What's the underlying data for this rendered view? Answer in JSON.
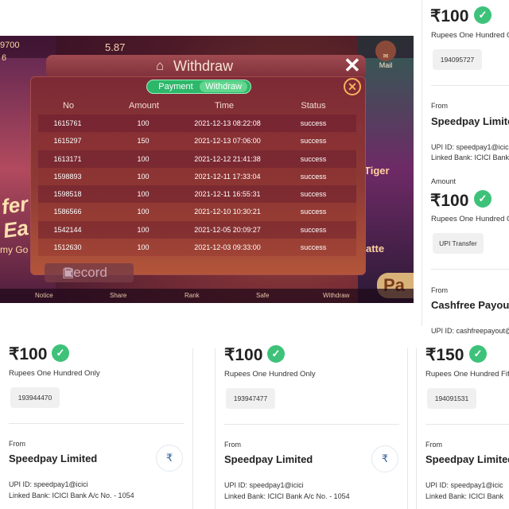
{
  "game": {
    "balance_a": "9700",
    "balance_b": "6",
    "balance_c": "5.87",
    "mail_label": "Mail",
    "side_promo_a": "fer",
    "side_promo_b": "Ea",
    "side_promo_c": "my Go",
    "side_tiger": "Tiger",
    "side_latte": "atte",
    "side_pay": "Pa",
    "withdraw_title": "Withdraw",
    "close_x": "✕",
    "toggle_payment": "Payment",
    "toggle_withdraw": "Withdraw",
    "close_circle": "✕",
    "columns": [
      "No",
      "Amount",
      "Time",
      "Status"
    ],
    "rows": [
      {
        "no": "1615761",
        "amount": "100",
        "time": "2021-12-13 08:22:08",
        "status": "success"
      },
      {
        "no": "1615297",
        "amount": "150",
        "time": "2021-12-13 07:06:00",
        "status": "success"
      },
      {
        "no": "1613171",
        "amount": "100",
        "time": "2021-12-12 21:41:38",
        "status": "success"
      },
      {
        "no": "1598893",
        "amount": "100",
        "time": "2021-12-11 17:33:04",
        "status": "success"
      },
      {
        "no": "1598518",
        "amount": "100",
        "time": "2021-12-11 16:55:31",
        "status": "success"
      },
      {
        "no": "1586566",
        "amount": "100",
        "time": "2021-12-10 10:30:21",
        "status": "success"
      },
      {
        "no": "1542144",
        "amount": "100",
        "time": "2021-12-05 20:09:27",
        "status": "success"
      },
      {
        "no": "1512630",
        "amount": "100",
        "time": "2021-12-03 09:33:00",
        "status": "success"
      }
    ],
    "record_label": "Record",
    "nav": [
      "Notice",
      "Share",
      "Rank",
      "Safe",
      "Withdraw"
    ]
  },
  "right_column": {
    "top": {
      "amount": "₹100",
      "words": "Rupees One Hundred Onl",
      "txn_id": "194095727",
      "from_label": "From",
      "from_name": "Speedpay Limite",
      "upi": "UPI ID: speedpay1@icic",
      "bank": "Linked Bank: ICICI Bank"
    },
    "middle": {
      "amount_label": "Amount",
      "amount": "₹100",
      "words": "Rupees One Hundred Onl",
      "mode": "UPI Transfer",
      "from_label": "From",
      "from_name": "Cashfree Payout",
      "upi": "UPI ID: cashfreepayout@"
    }
  },
  "cards": [
    {
      "amount": "₹100",
      "words": "Rupees One Hundred Only",
      "txn_id": "193944470",
      "from_label": "From",
      "from_name": "Speedpay Limited",
      "upi": "UPI ID: speedpay1@icici",
      "bank": "Linked Bank: ICICI Bank A/c No. - 1054"
    },
    {
      "amount": "₹100",
      "words": "Rupees One Hundred Only",
      "txn_id": "193947477",
      "from_label": "From",
      "from_name": "Speedpay Limited",
      "upi": "UPI ID: speedpay1@icici",
      "bank": "Linked Bank: ICICI Bank A/c No. - 1054"
    },
    {
      "amount": "₹150",
      "words": "Rupees One Hundred Fifty",
      "txn_id": "194091531",
      "from_label": "From",
      "from_name": "Speedpay Limited",
      "upi": "UPI ID: speedpay1@icic",
      "bank": "Linked Bank: ICICI Bank"
    }
  ],
  "icons": {
    "check": "✓",
    "rupee": "₹",
    "home": "⌂",
    "record": "▣"
  },
  "colors": {
    "verified_green": "#3ec27a",
    "toggle_green": "#2eb76a",
    "panel_red": "#7e2a36"
  }
}
